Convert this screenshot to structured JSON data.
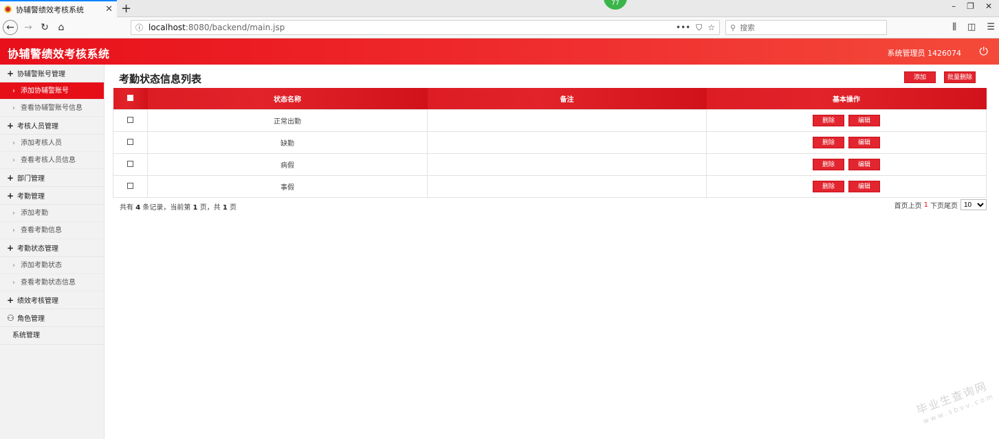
{
  "browser": {
    "tab_title": "协辅警绩效考核系统",
    "tab_close": "✕",
    "new_tab": "+",
    "badge": "77",
    "url_host": "localhost",
    "url_rest": ":8080/backend/main.jsp",
    "search_placeholder": "搜索"
  },
  "header": {
    "title": "协辅警绩效考核系统",
    "user": "系统管理员 1426074"
  },
  "sidebar": {
    "items": [
      {
        "type": "group",
        "label": "协辅警账号管理"
      },
      {
        "type": "sub",
        "label": "添加协辅警账号",
        "active": true
      },
      {
        "type": "sub",
        "label": "查看协辅警账号信息"
      },
      {
        "type": "group",
        "label": "考核人员管理"
      },
      {
        "type": "sub",
        "label": "添加考核人员"
      },
      {
        "type": "sub",
        "label": "查看考核人员信息"
      },
      {
        "type": "group",
        "label": "部门管理"
      },
      {
        "type": "group",
        "label": "考勤管理"
      },
      {
        "type": "sub",
        "label": "添加考勤"
      },
      {
        "type": "sub",
        "label": "查看考勤信息"
      },
      {
        "type": "group",
        "label": "考勤状态管理"
      },
      {
        "type": "sub",
        "label": "添加考勤状态"
      },
      {
        "type": "sub",
        "label": "查看考勤状态信息"
      },
      {
        "type": "group",
        "label": "绩效考核管理"
      },
      {
        "type": "group-icon",
        "label": "角色管理"
      },
      {
        "type": "plain",
        "label": "系统管理"
      }
    ]
  },
  "main": {
    "page_title": "考勤状态信息列表",
    "add_label": "添加",
    "batch_delete_label": "批量删除",
    "columns": [
      "状态名称",
      "备注",
      "基本操作"
    ],
    "rows": [
      {
        "name": "正常出勤",
        "remark": ""
      },
      {
        "name": "缺勤",
        "remark": ""
      },
      {
        "name": "病假",
        "remark": ""
      },
      {
        "name": "事假",
        "remark": ""
      }
    ],
    "delete_label": "删除",
    "edit_label": "编辑",
    "footer": {
      "prefix": "共有",
      "total": "4",
      "mid1": "条记录，当前第",
      "page": "1",
      "mid2": "页，共",
      "pages": "1",
      "suffix": "页"
    },
    "pager": {
      "first": "首页",
      "prev": "上页",
      "current": "1",
      "next": "下页",
      "last": "尾页",
      "page_size": "10"
    }
  },
  "watermark": {
    "line1": "毕业生查询网",
    "line2": "www.sbvv.com"
  }
}
